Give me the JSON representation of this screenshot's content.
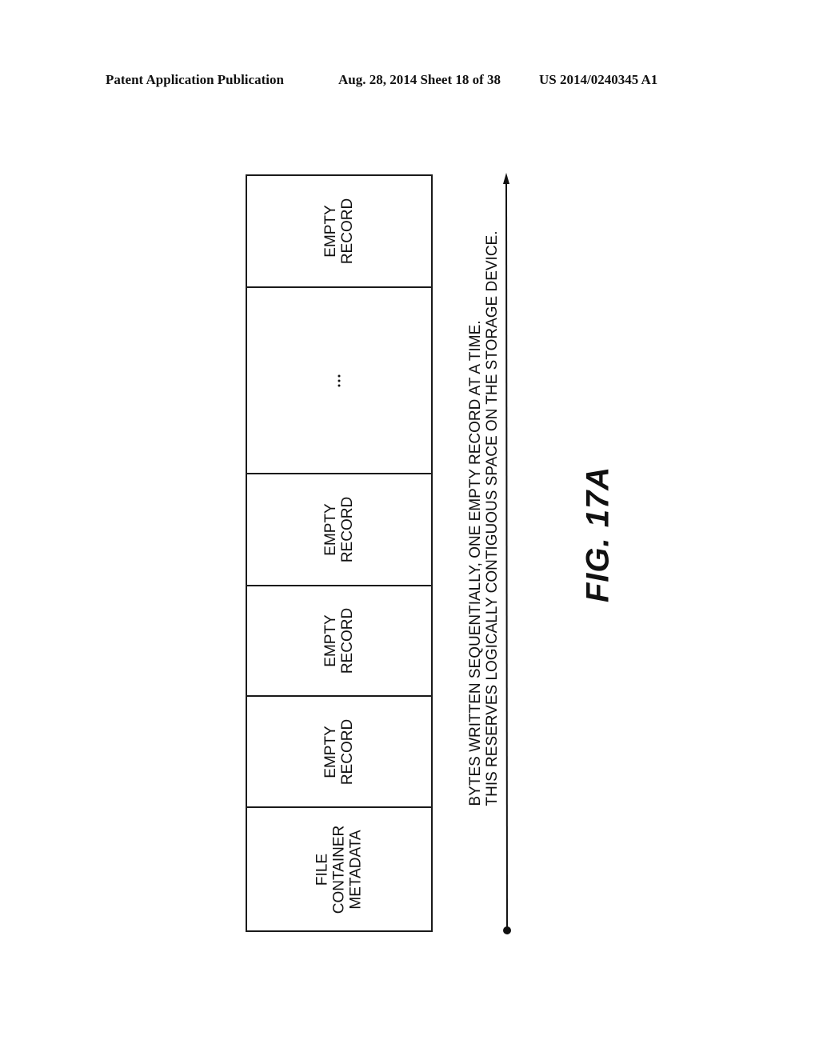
{
  "header": {
    "publication": "Patent Application Publication",
    "date_sheet": "Aug. 28, 2014  Sheet 18 of 38",
    "patent_number": "US 2014/0240345 A1"
  },
  "diagram": {
    "cells_top_to_bottom": [
      {
        "label": "EMPTY\nRECORD",
        "type": "record"
      },
      {
        "label": "",
        "type": "ellipsis",
        "glyph": "vertical-ellipsis"
      },
      {
        "label": "EMPTY\nRECORD",
        "type": "record"
      },
      {
        "label": "EMPTY\nRECORD",
        "type": "record"
      },
      {
        "label": "EMPTY\nRECORD",
        "type": "record"
      },
      {
        "label": "FILE\nCONTAINER\nMETADATA",
        "type": "metadata"
      }
    ],
    "arrow": {
      "direction": "up",
      "start_marker": "dot",
      "end_marker": "arrowhead",
      "caption": "BYTES WRITTEN SEQUENTIALLY, ONE EMPTY RECORD AT A TIME.\nTHIS RESERVES LOGICALLY CONTIGUOUS SPACE ON THE STORAGE DEVICE."
    },
    "figure_label": "FIG. 17A"
  }
}
